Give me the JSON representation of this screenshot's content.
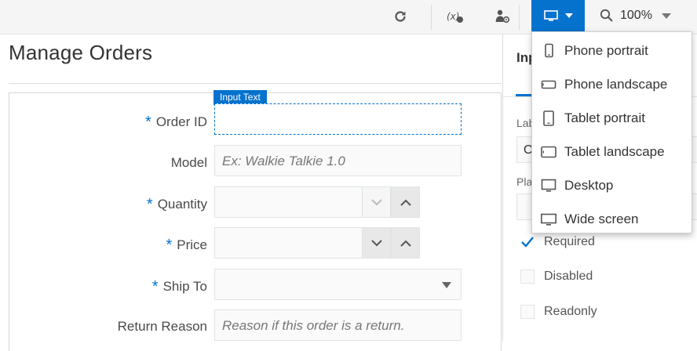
{
  "toolbar": {
    "refresh_icon": "refresh-icon",
    "variable_icon": "variable-x-icon",
    "user_settings_icon": "user-settings-icon",
    "device_icon": "monitor-icon",
    "zoom_value": "100%",
    "accent": "#0572ce"
  },
  "page": {
    "title": "Manage Orders"
  },
  "form": {
    "selected_badge": "Input Text",
    "fields": {
      "order_id": {
        "label": "Order ID",
        "required": "*"
      },
      "model": {
        "label": "Model",
        "placeholder": "Ex: Walkie Talkie 1.0"
      },
      "quantity": {
        "label": "Quantity",
        "required": "*"
      },
      "price": {
        "label": "Price",
        "required": "*"
      },
      "ship_to": {
        "label": "Ship To",
        "required": "*"
      },
      "return_reason": {
        "label": "Return Reason",
        "placeholder": "Reason if this order is a return."
      }
    }
  },
  "properties": {
    "title": "Inp",
    "label_caption": "Lab",
    "label_value": "O",
    "placeholder_caption": "Pla",
    "checkboxes": [
      {
        "label": "Required",
        "checked": true
      },
      {
        "label": "Disabled",
        "checked": false
      },
      {
        "label": "Readonly",
        "checked": false
      }
    ]
  },
  "device_menu": {
    "items": [
      {
        "label": "Phone portrait",
        "icon": "phone-portrait-icon"
      },
      {
        "label": "Phone landscape",
        "icon": "phone-landscape-icon"
      },
      {
        "label": "Tablet portrait",
        "icon": "tablet-portrait-icon"
      },
      {
        "label": "Tablet landscape",
        "icon": "tablet-landscape-icon"
      },
      {
        "label": "Desktop",
        "icon": "desktop-icon"
      },
      {
        "label": "Wide screen",
        "icon": "wide-screen-icon"
      }
    ]
  }
}
